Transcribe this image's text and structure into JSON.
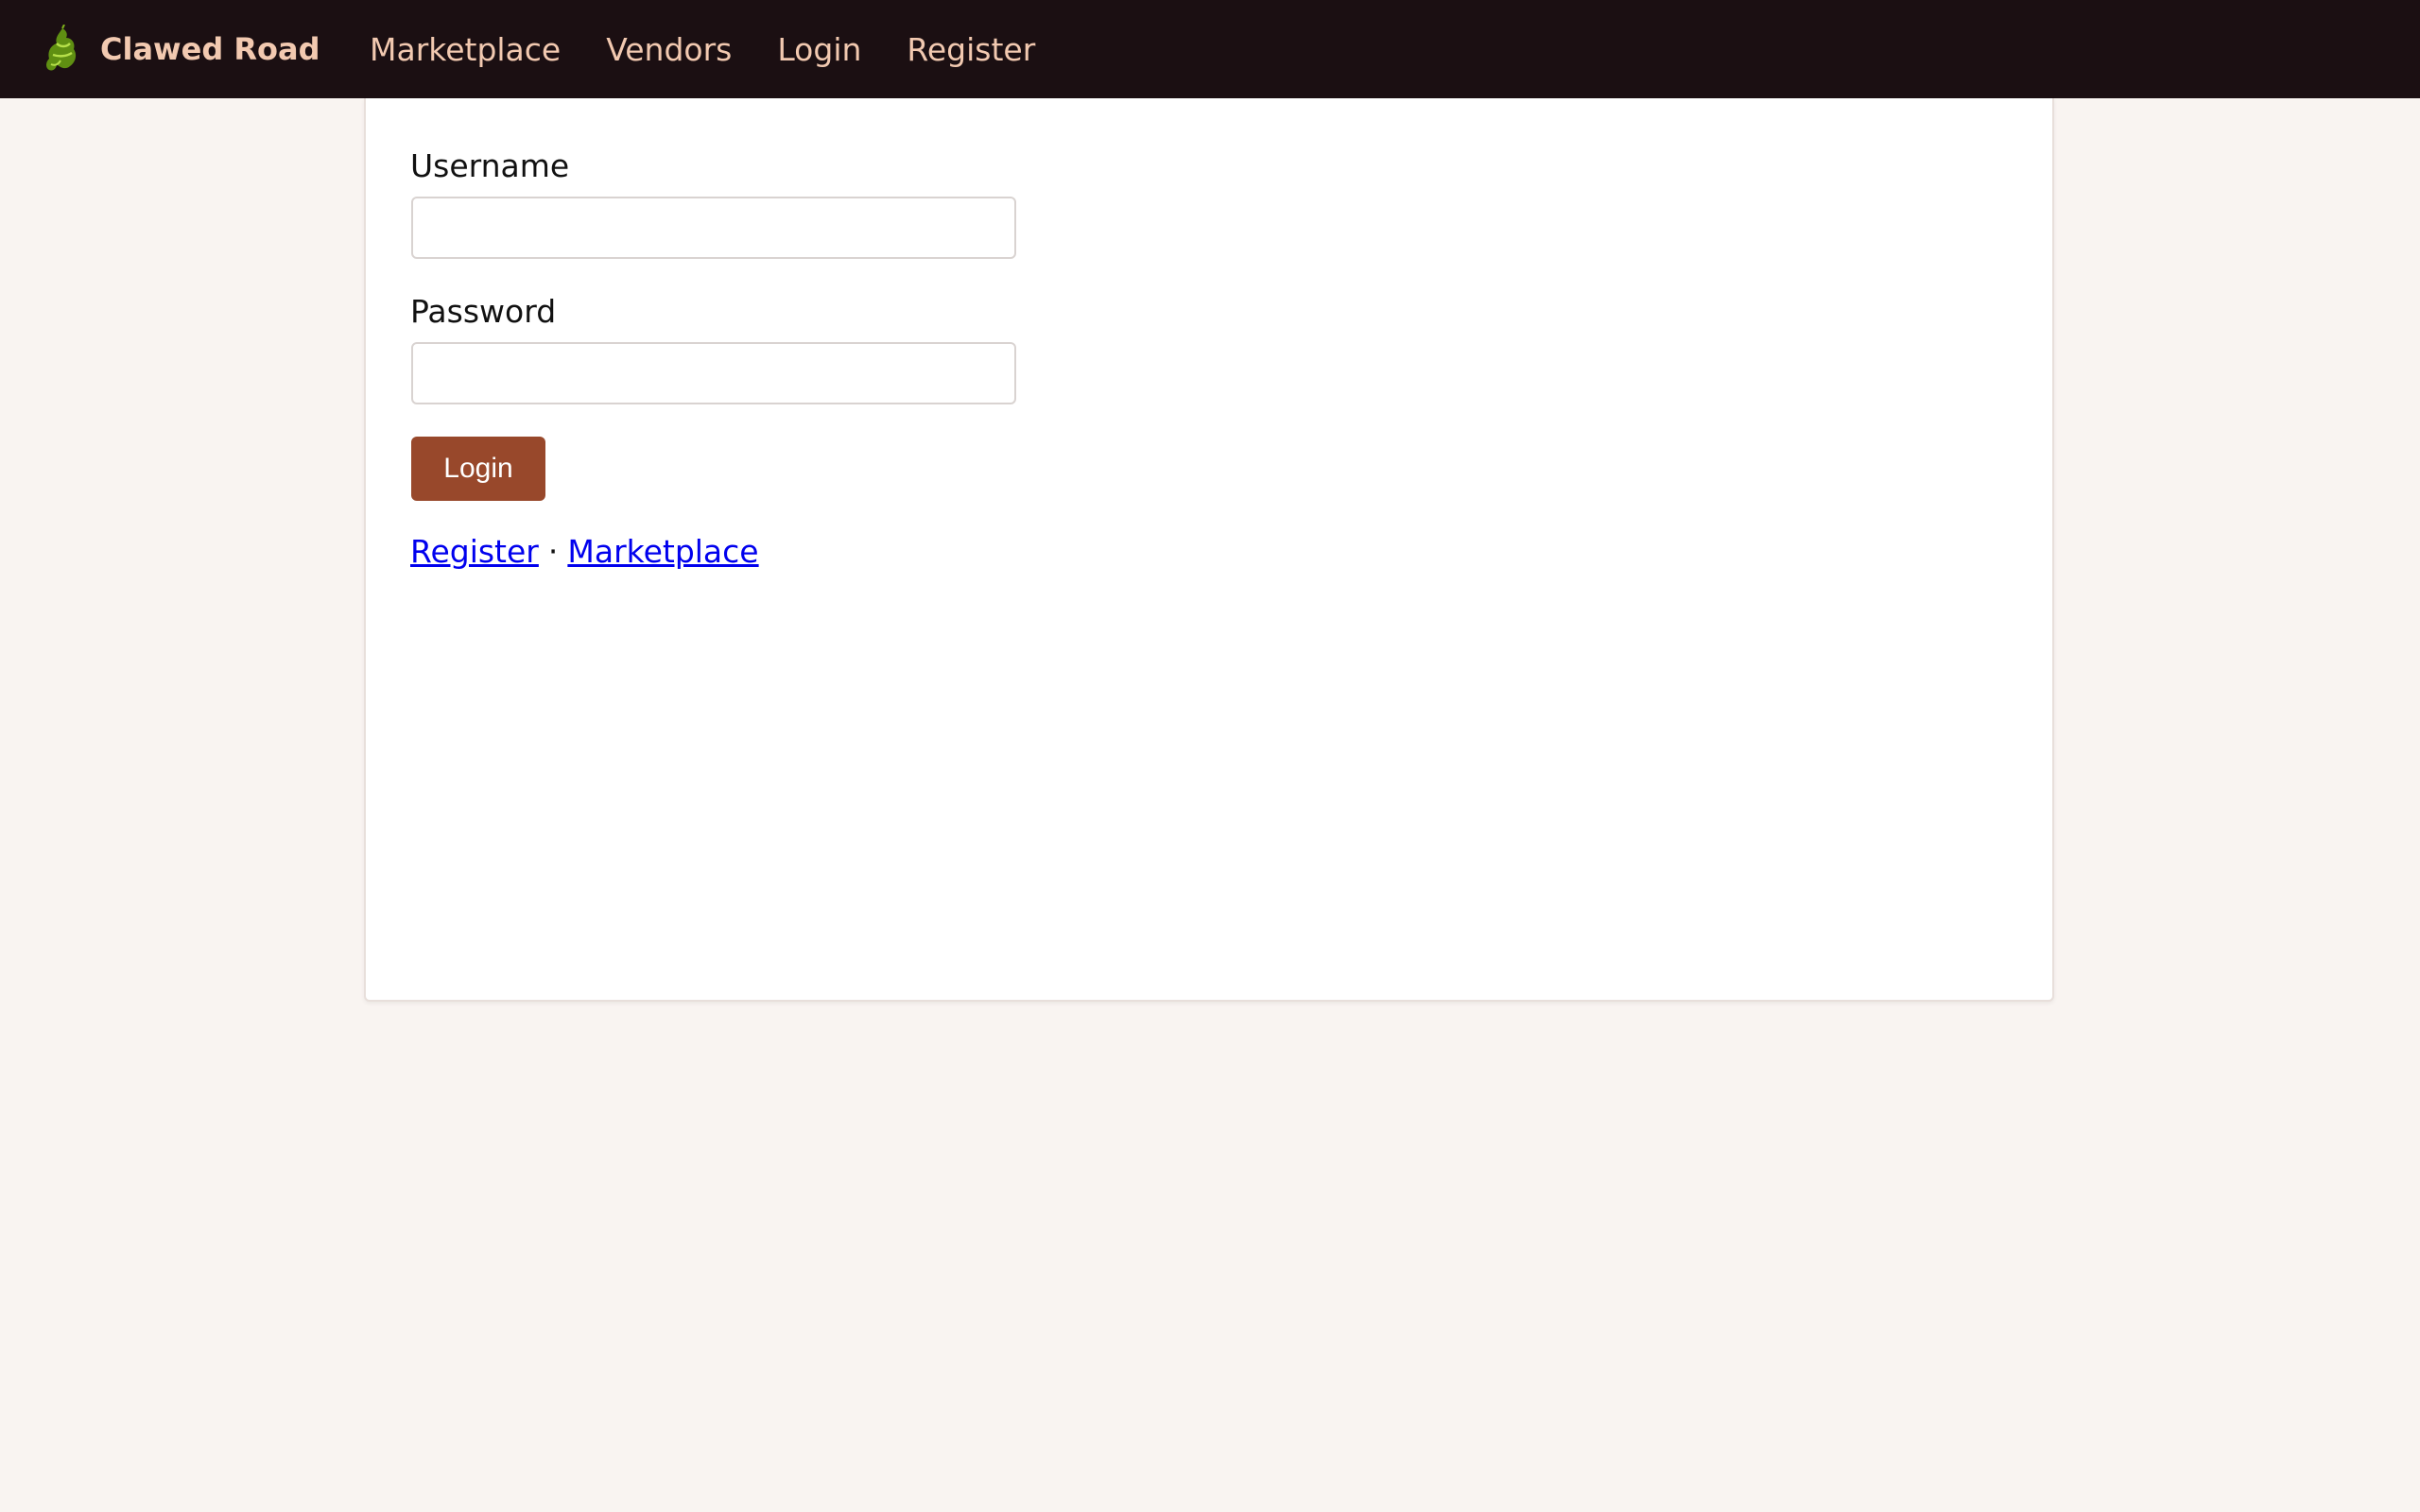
{
  "navbar": {
    "brand": {
      "icon": "lobster-claw-icon",
      "name": "Clawed Road"
    },
    "links": [
      {
        "label": "Marketplace"
      },
      {
        "label": "Vendors"
      },
      {
        "label": "Login"
      },
      {
        "label": "Register"
      }
    ]
  },
  "login_form": {
    "username_label": "Username",
    "username_value": "",
    "password_label": "Password",
    "password_value": "",
    "submit_label": "Login"
  },
  "footer_links": {
    "register": "Register",
    "separator": "·",
    "marketplace": "Marketplace"
  },
  "colors": {
    "navbar_bg": "#1b0f12",
    "nav_text": "#f2c9b0",
    "page_bg": "#f9f4f1",
    "button_bg": "#98482b",
    "link": "#0000ee",
    "icon_green": "#7fb21c"
  }
}
